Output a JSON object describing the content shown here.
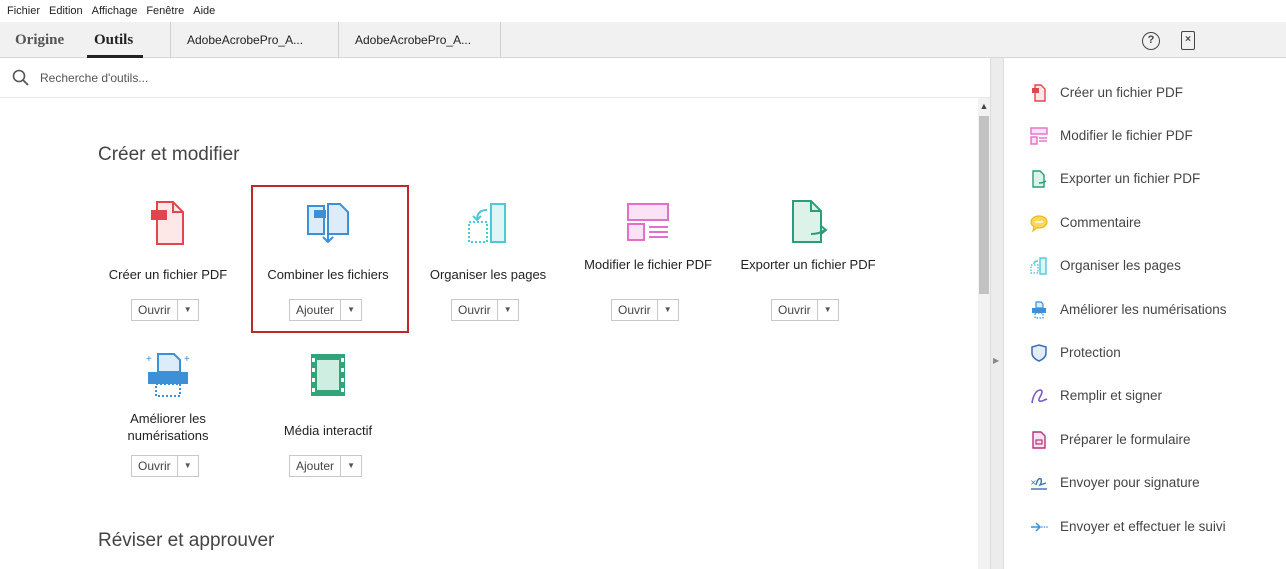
{
  "menu": [
    "Fichier",
    "Edition",
    "Affichage",
    "Fenêtre",
    "Aide"
  ],
  "tabs": {
    "home": "Origine",
    "tools": "Outils",
    "documents": [
      "AdobeAcrobePro_A...",
      "AdobeAcrobePro_A..."
    ]
  },
  "header_icons": {
    "help": "?",
    "close": "×"
  },
  "search": {
    "placeholder": "Recherche d'outils..."
  },
  "sections": [
    {
      "title": "Créer et modifier"
    },
    {
      "title": "Réviser et approuver"
    }
  ],
  "tools": [
    {
      "label": "Créer un fichier PDF",
      "button": "Ouvrir",
      "icon": "create-pdf-icon"
    },
    {
      "label": "Combiner les fichiers",
      "button": "Ajouter",
      "icon": "combine-files-icon",
      "highlighted": true
    },
    {
      "label": "Organiser les pages",
      "button": "Ouvrir",
      "icon": "organize-pages-icon"
    },
    {
      "label": "Modifier le fichier PDF",
      "button": "Ouvrir",
      "icon": "edit-pdf-icon"
    },
    {
      "label": "Exporter un fichier PDF",
      "button": "Ouvrir",
      "icon": "export-pdf-icon"
    },
    {
      "label": "Améliorer les numérisations",
      "button": "Ouvrir",
      "icon": "enhance-scans-icon"
    },
    {
      "label": "Média interactif",
      "button": "Ajouter",
      "icon": "rich-media-icon"
    }
  ],
  "right_panel": [
    {
      "label": "Créer un fichier PDF",
      "icon": "create-pdf-icon"
    },
    {
      "label": "Modifier le fichier PDF",
      "icon": "edit-pdf-icon"
    },
    {
      "label": "Exporter un fichier PDF",
      "icon": "export-pdf-icon"
    },
    {
      "label": "Commentaire",
      "icon": "comment-icon"
    },
    {
      "label": "Organiser les pages",
      "icon": "organize-pages-icon"
    },
    {
      "label": "Améliorer les numérisations",
      "icon": "enhance-scans-icon"
    },
    {
      "label": "Protection",
      "icon": "shield-icon"
    },
    {
      "label": "Remplir et signer",
      "icon": "fill-sign-icon"
    },
    {
      "label": "Préparer le formulaire",
      "icon": "prepare-form-icon"
    },
    {
      "label": "Envoyer pour signature",
      "icon": "send-signature-icon"
    },
    {
      "label": "Envoyer et effectuer le suivi",
      "icon": "send-track-icon"
    }
  ],
  "colors": {
    "create": "#e0474c",
    "combine": "#3d8fd6",
    "organize": "#4fc9d6",
    "edit": "#e070c8",
    "export": "#2a9d7a",
    "scan": "#3d8fd6",
    "media": "#33a37a",
    "highlight": "#c0272d"
  }
}
